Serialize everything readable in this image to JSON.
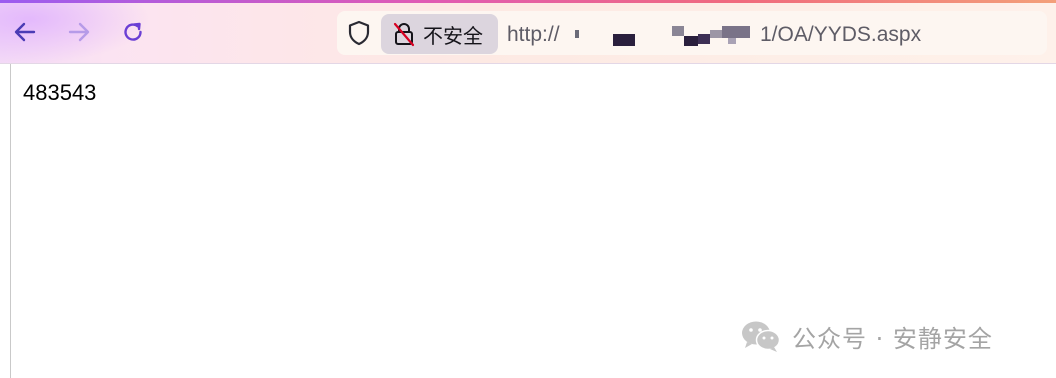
{
  "browser": {
    "nav": {
      "back_icon": "arrow-left-icon",
      "forward_icon": "arrow-right-icon",
      "reload_icon": "reload-icon"
    },
    "urlbar": {
      "security_icon": "shield-icon",
      "insecure_icon": "crossed-lock-icon",
      "insecure_label": "不安全",
      "url_prefix": "http://",
      "url_suffix": "1/OA/YYDS.aspx"
    },
    "colors": {
      "accent": "#6b3fd4",
      "forward_disabled": "#b69be8",
      "pill_bg": "#dcd5de"
    }
  },
  "page": {
    "body_text": "483543"
  },
  "watermark": {
    "icon": "wechat-icon",
    "text": "公众号 · 安静安全"
  }
}
